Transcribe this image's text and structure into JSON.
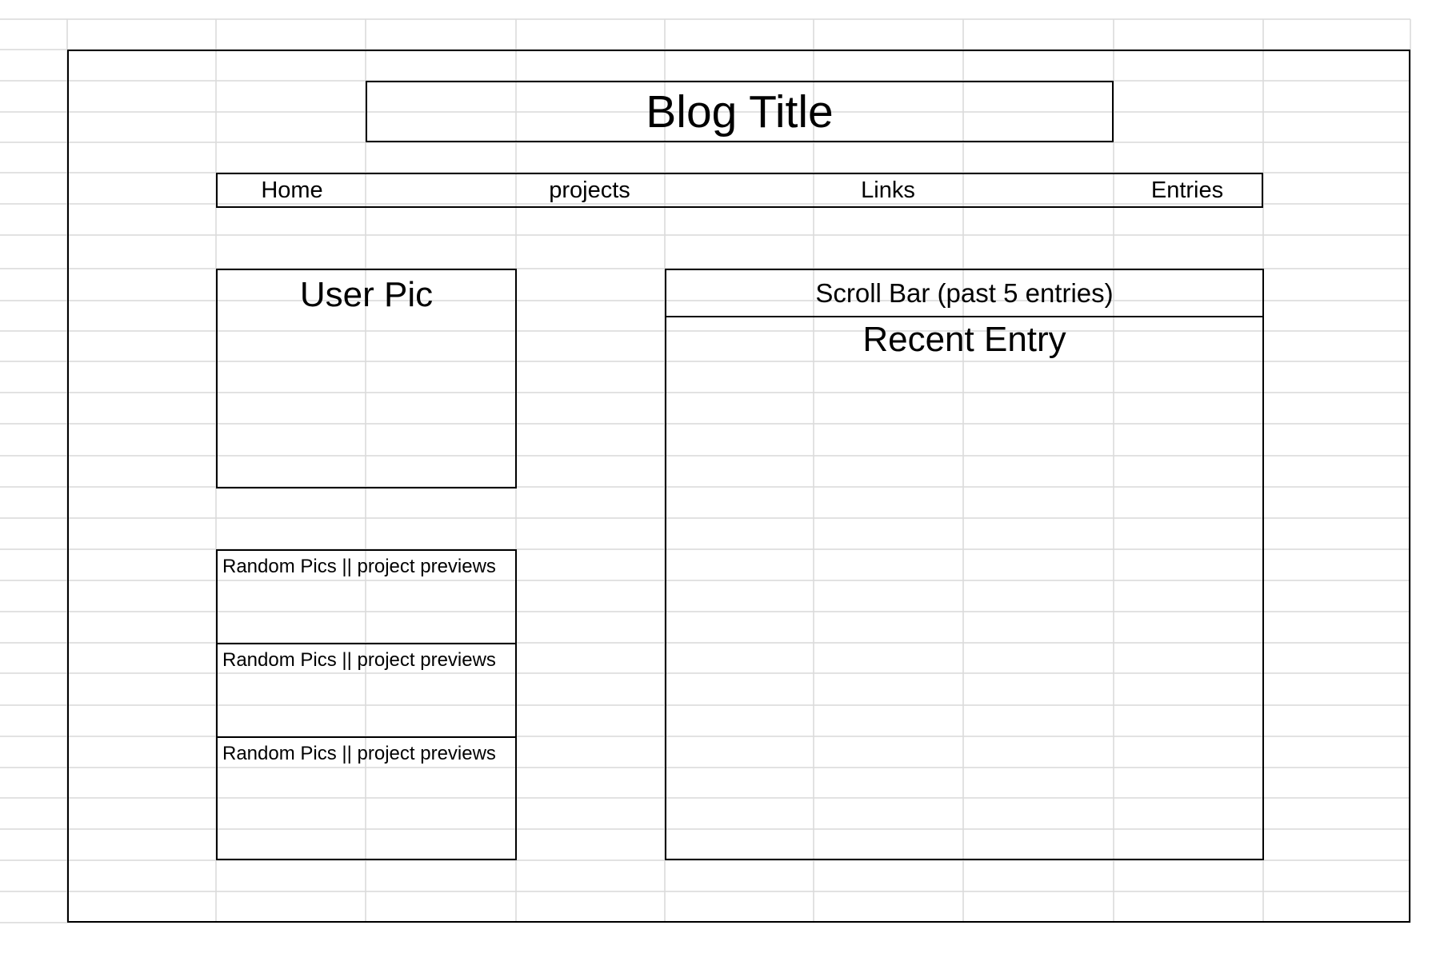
{
  "wireframe": {
    "blog_title": "Blog Title",
    "nav": [
      "Home",
      "projects",
      "Links",
      "Entries"
    ],
    "user_pic": "User Pic",
    "previews": [
      "Random Pics || project previews",
      "Random Pics || project previews",
      "Random Pics || project previews"
    ],
    "scroll_bar": "Scroll Bar (past 5 entries)",
    "recent_entry": "Recent Entry"
  },
  "colors": {
    "gridline": "#d9d9d9",
    "border": "#000000",
    "background": "#ffffff"
  }
}
